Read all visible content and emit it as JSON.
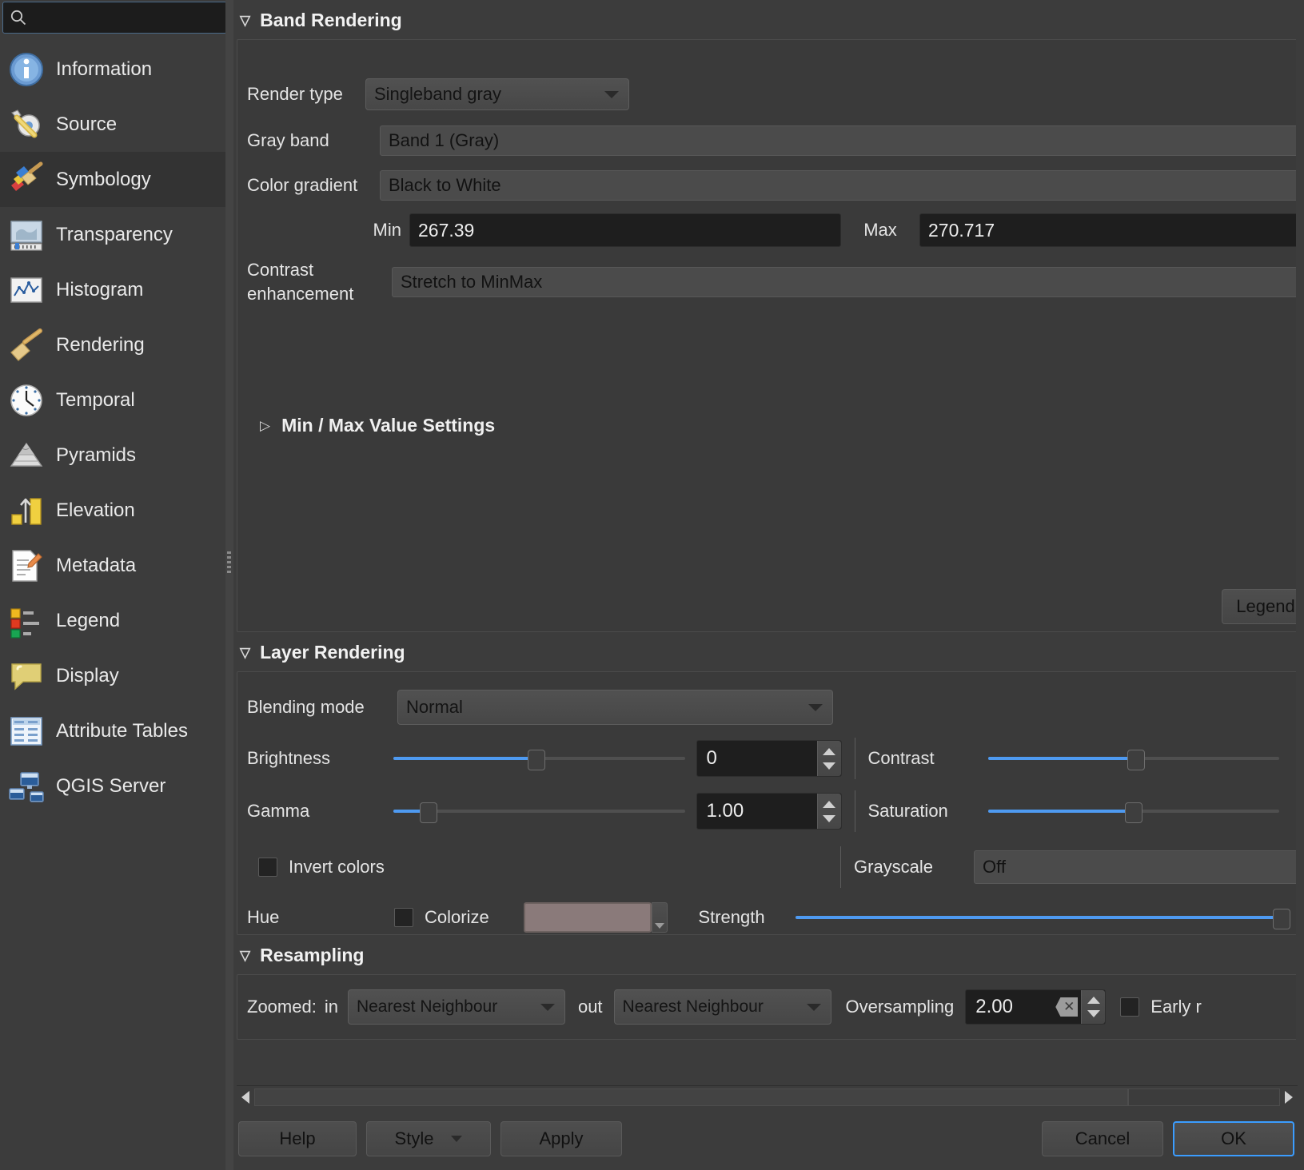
{
  "sidebar": {
    "search": {
      "placeholder": "",
      "value": ""
    },
    "items": [
      {
        "label": "Information",
        "icon": "information-icon",
        "selected": false
      },
      {
        "label": "Source",
        "icon": "source-icon",
        "selected": false
      },
      {
        "label": "Symbology",
        "icon": "symbology-icon",
        "selected": true
      },
      {
        "label": "Transparency",
        "icon": "transparency-icon",
        "selected": false
      },
      {
        "label": "Histogram",
        "icon": "histogram-icon",
        "selected": false
      },
      {
        "label": "Rendering",
        "icon": "rendering-icon",
        "selected": false
      },
      {
        "label": "Temporal",
        "icon": "temporal-icon",
        "selected": false
      },
      {
        "label": "Pyramids",
        "icon": "pyramids-icon",
        "selected": false
      },
      {
        "label": "Elevation",
        "icon": "elevation-icon",
        "selected": false
      },
      {
        "label": "Metadata",
        "icon": "metadata-icon",
        "selected": false
      },
      {
        "label": "Legend",
        "icon": "legend-icon",
        "selected": false
      },
      {
        "label": "Display",
        "icon": "display-icon",
        "selected": false
      },
      {
        "label": "Attribute Tables",
        "icon": "attribute-tables-icon",
        "selected": false
      },
      {
        "label": "QGIS Server",
        "icon": "qgis-server-icon",
        "selected": false
      }
    ]
  },
  "band_rendering": {
    "title": "Band Rendering",
    "render_type_label": "Render type",
    "render_type_value": "Singleband gray",
    "gray_band_label": "Gray band",
    "gray_band_value": "Band 1 (Gray)",
    "color_gradient_label": "Color gradient",
    "color_gradient_value": "Black to White",
    "min_label": "Min",
    "min_value": "267.39",
    "max_label": "Max",
    "max_value": "270.717",
    "contrast_enhancement_label_line1": "Contrast",
    "contrast_enhancement_label_line2": "enhancement",
    "contrast_enhancement_value": "Stretch to MinMax",
    "min_max_settings_label": "Min / Max Value Settings",
    "legend_button_label": "Legend"
  },
  "layer_rendering": {
    "title": "Layer Rendering",
    "blending_mode_label": "Blending mode",
    "blending_mode_value": "Normal",
    "brightness_label": "Brightness",
    "brightness_value": "0",
    "brightness_percent": 48,
    "contrast_label": "Contrast",
    "contrast_percent": 50,
    "gamma_label": "Gamma",
    "gamma_value": "1.00",
    "gamma_percent": 11,
    "saturation_label": "Saturation",
    "saturation_percent": 49,
    "invert_colors_label": "Invert colors",
    "invert_colors_checked": false,
    "grayscale_label": "Grayscale",
    "grayscale_value": "Off",
    "hue_label": "Hue",
    "colorize_label": "Colorize",
    "colorize_checked": false,
    "colorize_color": "#8a7a7a",
    "strength_label": "Strength",
    "strength_percent": 99
  },
  "resampling": {
    "title": "Resampling",
    "zoomed_label": "Zoomed:",
    "in_label": "in",
    "zoomed_in_value": "Nearest Neighbour",
    "out_label": "out",
    "zoomed_out_value": "Nearest Neighbour",
    "oversampling_label": "Oversampling",
    "oversampling_value": "2.00",
    "early_resampling_label": "Early r",
    "early_resampling_checked": false
  },
  "footer": {
    "help_label": "Help",
    "style_label": "Style",
    "apply_label": "Apply",
    "cancel_label": "Cancel",
    "ok_label": "OK"
  },
  "colors": {
    "accent": "#4e9af1",
    "panel_bg": "#3c3c3c",
    "field_bg": "#1e1e1e"
  }
}
